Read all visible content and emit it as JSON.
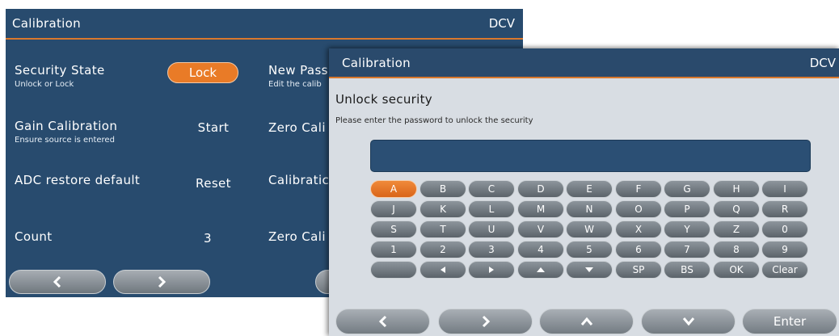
{
  "background_window": {
    "title": "Calibration",
    "mode": "DCV",
    "rows": [
      {
        "label": "Security State",
        "sublabel": "Unlock or Lock",
        "value": "Lock"
      },
      {
        "label": "Gain Calibration",
        "sublabel": "Ensure source is entered",
        "value": "Start"
      },
      {
        "label": "ADC restore default",
        "sublabel": "",
        "value": "Reset"
      },
      {
        "label": "Count",
        "sublabel": "",
        "value": "3"
      }
    ],
    "right_col": [
      {
        "label": "New Pass",
        "sublabel": "Edit the calib"
      },
      {
        "label": "Zero Cali"
      },
      {
        "label": "Calibratic"
      },
      {
        "label": "Zero Cali"
      }
    ],
    "nav": {
      "prev_icon": "chevron-left-icon",
      "next_icon": "chevron-right-icon"
    }
  },
  "dialog": {
    "title": "Calibration",
    "mode": "DCV",
    "heading": "Unlock security",
    "description": "Please enter the password to unlock the security",
    "password_value": "",
    "keyboard_rows": [
      [
        "A",
        "B",
        "C",
        "D",
        "E",
        "F",
        "G",
        "H",
        "I"
      ],
      [
        "J",
        "K",
        "L",
        "M",
        "N",
        "O",
        "P",
        "Q",
        "R"
      ],
      [
        "S",
        "T",
        "U",
        "V",
        "W",
        "X",
        "Y",
        "Z",
        "0"
      ],
      [
        "1",
        "2",
        "3",
        "4",
        "5",
        "6",
        "7",
        "8",
        "9"
      ],
      [
        "",
        "◀",
        "▶",
        "▲",
        "▼",
        "SP",
        "BS",
        "OK",
        "Clear"
      ]
    ],
    "selected_key": "A",
    "nav": {
      "enter_label": "Enter"
    }
  },
  "colors": {
    "accent": "#e97b27",
    "panel": "#284b6e",
    "dialog_bg": "#d8dde3"
  }
}
